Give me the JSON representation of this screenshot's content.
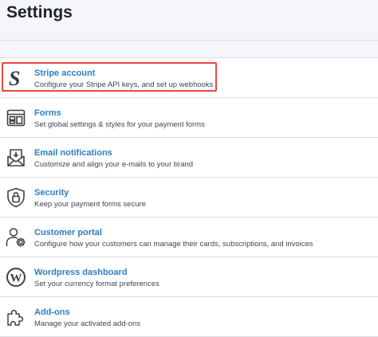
{
  "page": {
    "title": "Settings"
  },
  "settings": {
    "items": [
      {
        "icon": "stripe-logo-icon",
        "label": "Stripe account",
        "description": "Configure your Stripe API keys, and set up webhooks",
        "highlighted": true
      },
      {
        "icon": "forms-icon",
        "label": "Forms",
        "description": "Set global settings & styles for your payment forms"
      },
      {
        "icon": "email-icon",
        "label": "Email notifications",
        "description": "Customize and align your e-mails to your brand"
      },
      {
        "icon": "shield-lock-icon",
        "label": "Security",
        "description": "Keep your payment forms secure"
      },
      {
        "icon": "customer-gear-icon",
        "label": "Customer portal",
        "description": "Configure how your customers can manage their cards, subscriptions, and invoices"
      },
      {
        "icon": "wordpress-icon",
        "label": "Wordpress dashboard",
        "description": "Set your currency format preferences"
      },
      {
        "icon": "puzzle-icon",
        "label": "Add-ons",
        "description": "Manage your activated add-ons"
      }
    ]
  },
  "colors": {
    "link": "#2e7ec4",
    "highlight_border": "#e8473f",
    "icon": "#3b4048"
  }
}
